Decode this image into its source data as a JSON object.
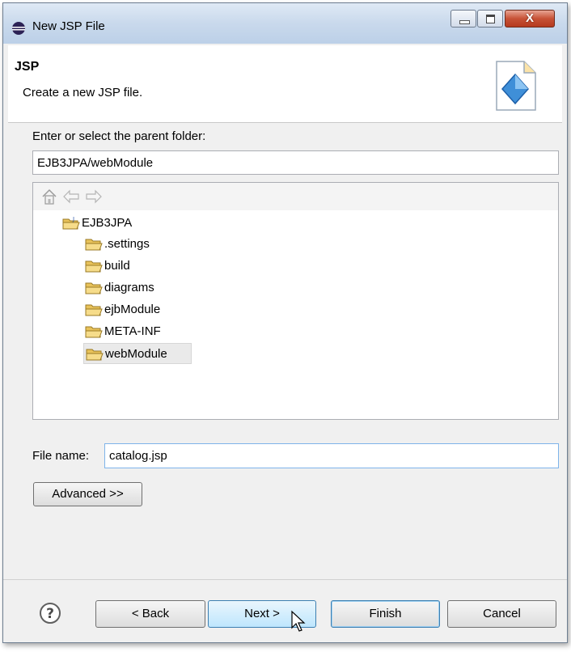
{
  "window": {
    "title": "New JSP File",
    "close_glyph": "X"
  },
  "banner": {
    "title": "JSP",
    "description": "Create a new JSP file.",
    "icon": "jsp-file-wizard-icon"
  },
  "parent_folder": {
    "label": "Enter or select the parent folder:",
    "value": "EJB3JPA/webModule"
  },
  "tree": {
    "project": "EJB3JPA",
    "folders": [
      ".settings",
      "build",
      "diagrams",
      "ejbModule",
      "META-INF",
      "webModule"
    ],
    "selected": "webModule"
  },
  "file_name": {
    "label": "File name:",
    "value": "catalog.jsp"
  },
  "buttons": {
    "advanced": "Advanced >>",
    "back": "< Back",
    "next": "Next >",
    "finish": "Finish",
    "cancel": "Cancel"
  },
  "colors": {
    "folder": "#e8c25a",
    "accent": "#3c7fb1"
  }
}
